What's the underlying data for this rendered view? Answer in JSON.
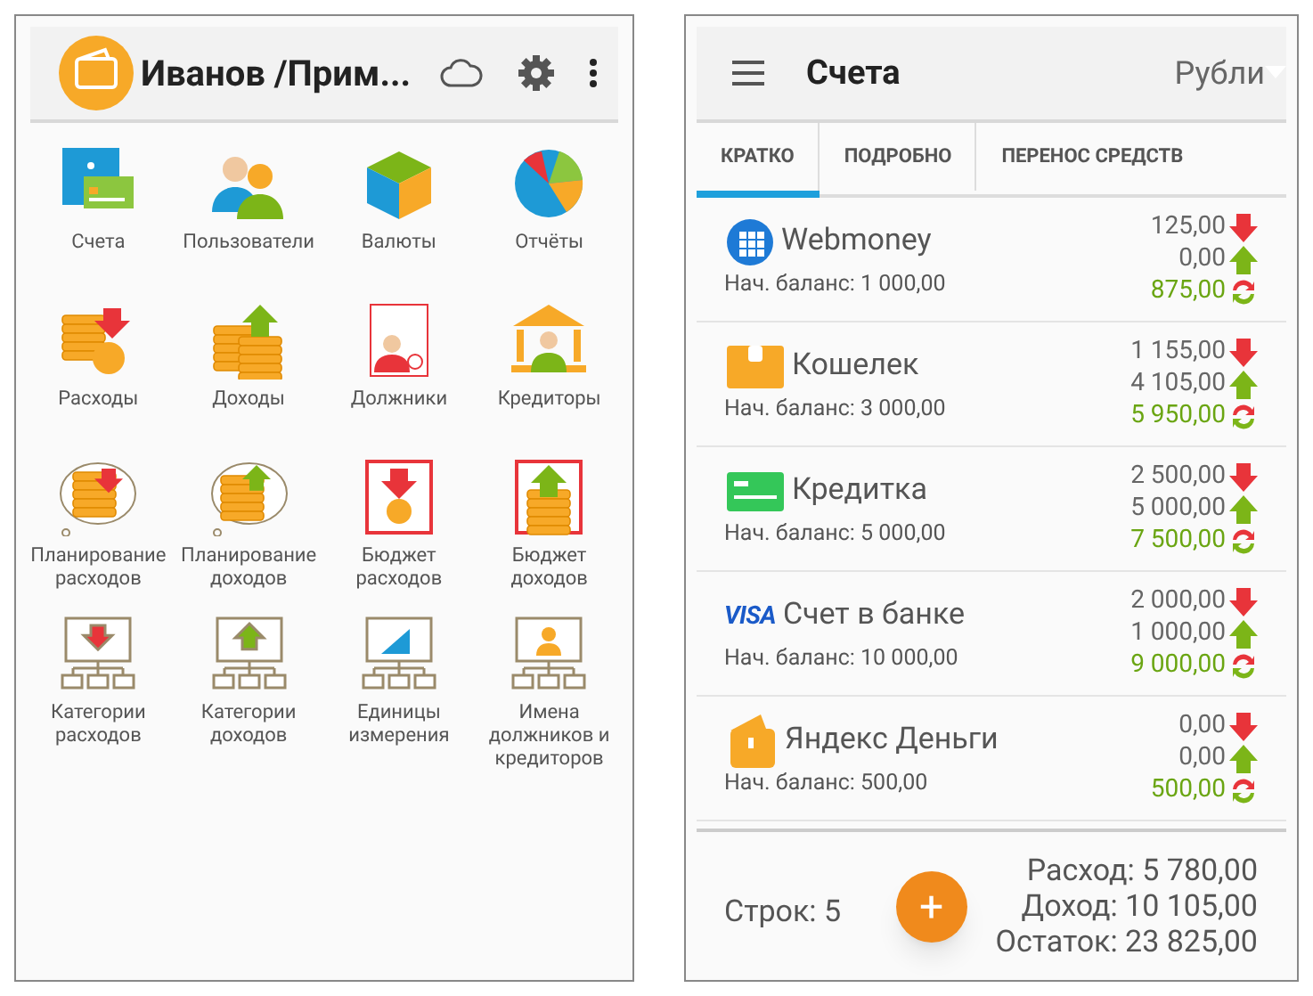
{
  "left": {
    "title": "Иванов /Прим...",
    "menu": [
      {
        "label": "Счета",
        "kind": "accounts"
      },
      {
        "label": "Пользователи",
        "kind": "users"
      },
      {
        "label": "Валюты",
        "kind": "currencies"
      },
      {
        "label": "Отчёты",
        "kind": "reports"
      },
      {
        "label": "Расходы",
        "kind": "expense"
      },
      {
        "label": "Доходы",
        "kind": "income"
      },
      {
        "label": "Должники",
        "kind": "debtors"
      },
      {
        "label": "Кредиторы",
        "kind": "creditors"
      },
      {
        "label": "Планирование расходов",
        "kind": "plan_expense"
      },
      {
        "label": "Планирование доходов",
        "kind": "plan_income"
      },
      {
        "label": "Бюджет расходов",
        "kind": "budget_expense"
      },
      {
        "label": "Бюджет доходов",
        "kind": "budget_income"
      },
      {
        "label": "Категории расходов",
        "kind": "cat_expense"
      },
      {
        "label": "Категории доходов",
        "kind": "cat_income"
      },
      {
        "label": "Единицы измерения",
        "kind": "cat_units"
      },
      {
        "label": "Имена должников и кредиторов",
        "kind": "cat_names"
      }
    ]
  },
  "right": {
    "title": "Счета",
    "currency": "Рубли",
    "tabs": [
      {
        "label": "КРАТКО",
        "selected": true
      },
      {
        "label": "ПОДРОБНО",
        "selected": false
      },
      {
        "label": "ПЕРЕНОС СРЕДСТВ",
        "selected": false
      }
    ],
    "accounts": [
      {
        "name": "Webmoney",
        "kind": "globe",
        "start": "Нач. баланс: 1 000,00",
        "expense": "125,00",
        "income": "0,00",
        "balance": "875,00"
      },
      {
        "name": "Кошелек",
        "kind": "wallet",
        "start": "Нач. баланс: 3 000,00",
        "expense": "1 155,00",
        "income": "4 105,00",
        "balance": "5 950,00"
      },
      {
        "name": "Кредитка",
        "kind": "card",
        "start": "Нач. баланс: 5 000,00",
        "expense": "2 500,00",
        "income": "5 000,00",
        "balance": "7 500,00"
      },
      {
        "name": "Счет в банке",
        "kind": "visa",
        "logo": "VISA",
        "start": "Нач. баланс: 10 000,00",
        "expense": "2 000,00",
        "income": "1 000,00",
        "balance": "9 000,00"
      },
      {
        "name": "Яндекс Деньги",
        "kind": "yandex",
        "start": "Нач. баланс: 500,00",
        "expense": "0,00",
        "income": "0,00",
        "balance": "500,00"
      }
    ],
    "fab": "+",
    "rows": "Строк: 5",
    "totals": [
      "Расход: 5 780,00",
      "Доход: 10 105,00",
      "Остаток: 23 825,00"
    ]
  }
}
